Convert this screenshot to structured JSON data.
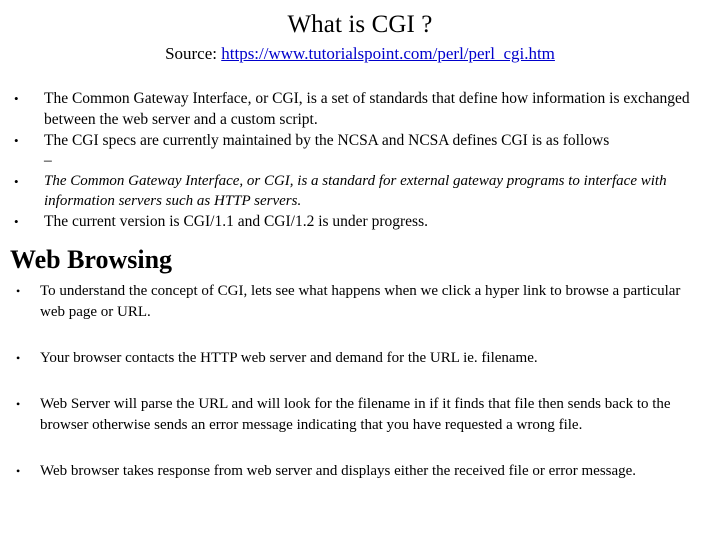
{
  "slide": {
    "title": "What is CGI ?",
    "source": {
      "label": "Source:",
      "url_text": "https://www.tutorialspoint.com/perl/perl_cgi.htm",
      "url_color": "#0000cc"
    },
    "bullet_glyph": "•",
    "top_bullets": [
      {
        "text": "The Common Gateway Interface, or CGI, is a set of standards that define how information is exchanged between the web server and a custom script.",
        "style": "normal"
      },
      {
        "text": "The CGI specs are currently maintained by the NCSA and NCSA defines CGI is as follows",
        "style": "normal",
        "trailing_dash": "–"
      },
      {
        "text": "The Common Gateway Interface, or CGI, is a standard for external gateway programs to interface with information servers such as HTTP servers.",
        "style": "italic"
      },
      {
        "text": "The current version is CGI/1.1 and CGI/1.2 is under progress.",
        "style": "normal"
      }
    ],
    "section_heading": "Web Browsing",
    "bottom_bullets": [
      {
        "text": "To understand the concept of CGI, lets see what happens when we click a hyper link to browse a particular web page or URL."
      },
      {
        "text": "Your browser contacts the HTTP web server and demand for the URL ie. filename."
      },
      {
        "text": "Web Server will parse the URL and will look for the filename in if it finds that file then sends back to the browser otherwise sends an error message indicating that you have requested a wrong file."
      },
      {
        "text": "Web browser takes response from web server and displays either the received file or error message."
      }
    ]
  }
}
